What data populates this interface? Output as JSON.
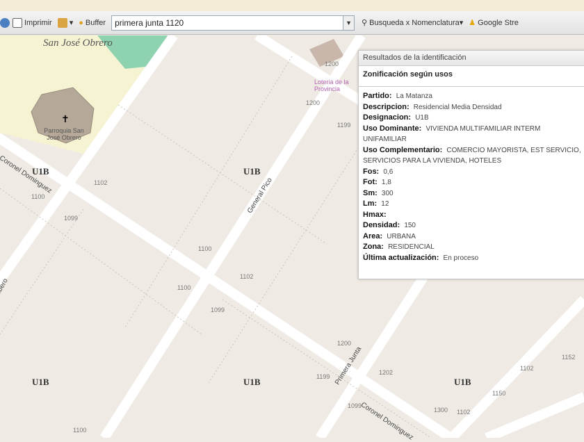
{
  "toolbar": {
    "print_label": "Imprimir",
    "buffer_label": "Buffer",
    "buffer_value": "primera junta 1120",
    "search_label": "Busqueda x Nomenclatura▾",
    "streetview_label": "Google Stre"
  },
  "map": {
    "place_name": "San José Obrero",
    "church_label": "Parroquia San José Obrero",
    "poi_label": "Loteria de la Provincia",
    "zones": [
      "U1B",
      "U1B",
      "U1B",
      "U1B",
      "U1B"
    ],
    "streets": [
      "Coronel Dominguez",
      "General Pico",
      "Primera Junta",
      "Coronel Dominguez",
      "Ibero"
    ],
    "numbers": [
      "1102",
      "1100",
      "1099",
      "1100",
      "1100",
      "1102",
      "1099",
      "1200",
      "1199",
      "1200",
      "1199",
      "1202",
      "1300",
      "1102",
      "1150",
      "1152",
      "1099",
      "1100",
      "1200",
      "1102"
    ]
  },
  "popup": {
    "title": "Resultados de la identificación",
    "subtitle": "Zonificación según usos",
    "rows": [
      {
        "k": "Partido:",
        "v": "La Matanza"
      },
      {
        "k": "Descripcion:",
        "v": "Residencial Media Densidad"
      },
      {
        "k": "Designacion:",
        "v": "U1B"
      },
      {
        "k": "Uso Dominante:",
        "v": "VIVIENDA MULTIFAMILIAR INTERM UNIFAMILIAR"
      },
      {
        "k": "Uso Complementario:",
        "v": "COMERCIO MAYORISTA, EST SERVICIO, SERVICIOS PARA LA VIVIENDA, HOTELES"
      },
      {
        "k": "Fos:",
        "v": "0,6"
      },
      {
        "k": "Fot:",
        "v": "1,8"
      },
      {
        "k": "Sm:",
        "v": "300"
      },
      {
        "k": "Lm:",
        "v": "12"
      },
      {
        "k": "Hmax:",
        "v": ""
      },
      {
        "k": "Densidad:",
        "v": "150"
      },
      {
        "k": "Area:",
        "v": "URBANA"
      },
      {
        "k": "Zona:",
        "v": "RESIDENCIAL"
      },
      {
        "k": "Última actualización:",
        "v": "En proceso"
      }
    ]
  }
}
